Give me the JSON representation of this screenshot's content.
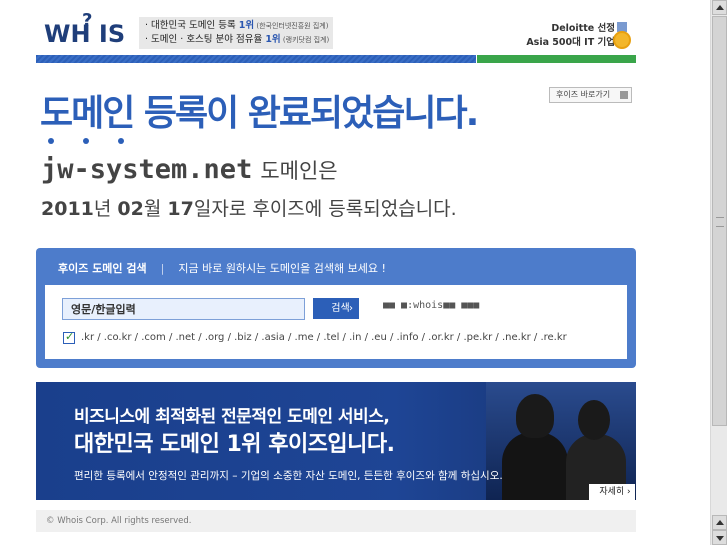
{
  "header": {
    "logo_text": "WH IS",
    "logo_q": "?",
    "rank": {
      "line1_prefix": "· 대한민국 도메인 등록 ",
      "line1_rank": "1위",
      "line1_note": " (한국인터넷진흥원 집계)",
      "line2_prefix": "· 도메인 · 호스팅 분야 점유율 ",
      "line2_rank": "1위",
      "line2_note": " (랭키닷컴 집계)"
    },
    "award": {
      "line1": "Deloitte 선정",
      "line2": "Asia 500대 IT 기업"
    },
    "accent_blue": "#2c5fb8",
    "accent_green": "#3aa54a"
  },
  "main": {
    "headline": "도메인 등록이 완료되었습니다.",
    "shortcut_label": "후이즈 바로가기",
    "domain_name": "jw-system.net",
    "domain_suffix": "도메인은",
    "date_year": "2011",
    "date_year_unit": "년 ",
    "date_month": "02",
    "date_month_unit": "월 ",
    "date_day": "17",
    "date_rest": "일자로 후이즈에 등록되었습니다."
  },
  "search": {
    "title": "후이즈 도메인 검색",
    "separator": "|",
    "subtitle": "지금 바로 원하시는 도메인을 검색해 보세요 !",
    "input_value": "영문/한글입력",
    "button_label": "검색",
    "button_chevron": "›",
    "whois_note": "■■ ■:whois■■ ■■■",
    "extensions": ".kr / .co.kr / .com / .net / .org / .biz / .asia / .me / .tel / .in / .eu / .info / .or.kr / .pe.kr / .ne.kr / .re.kr",
    "checkbox_checked": true
  },
  "banner": {
    "line1": "비즈니스에 최적화된 전문적인 도메인 서비스,",
    "line2": "대한민국 도메인 1위 후이즈입니다.",
    "line3": "편리한 등록에서 안정적인 관리까지 – 기업의 소중한 자산 도메인, 든든한 후이즈와 함께 하십시오.",
    "more_label": "자세히 ›"
  },
  "footer": {
    "copyright": "© Whois Corp. All rights reserved."
  }
}
